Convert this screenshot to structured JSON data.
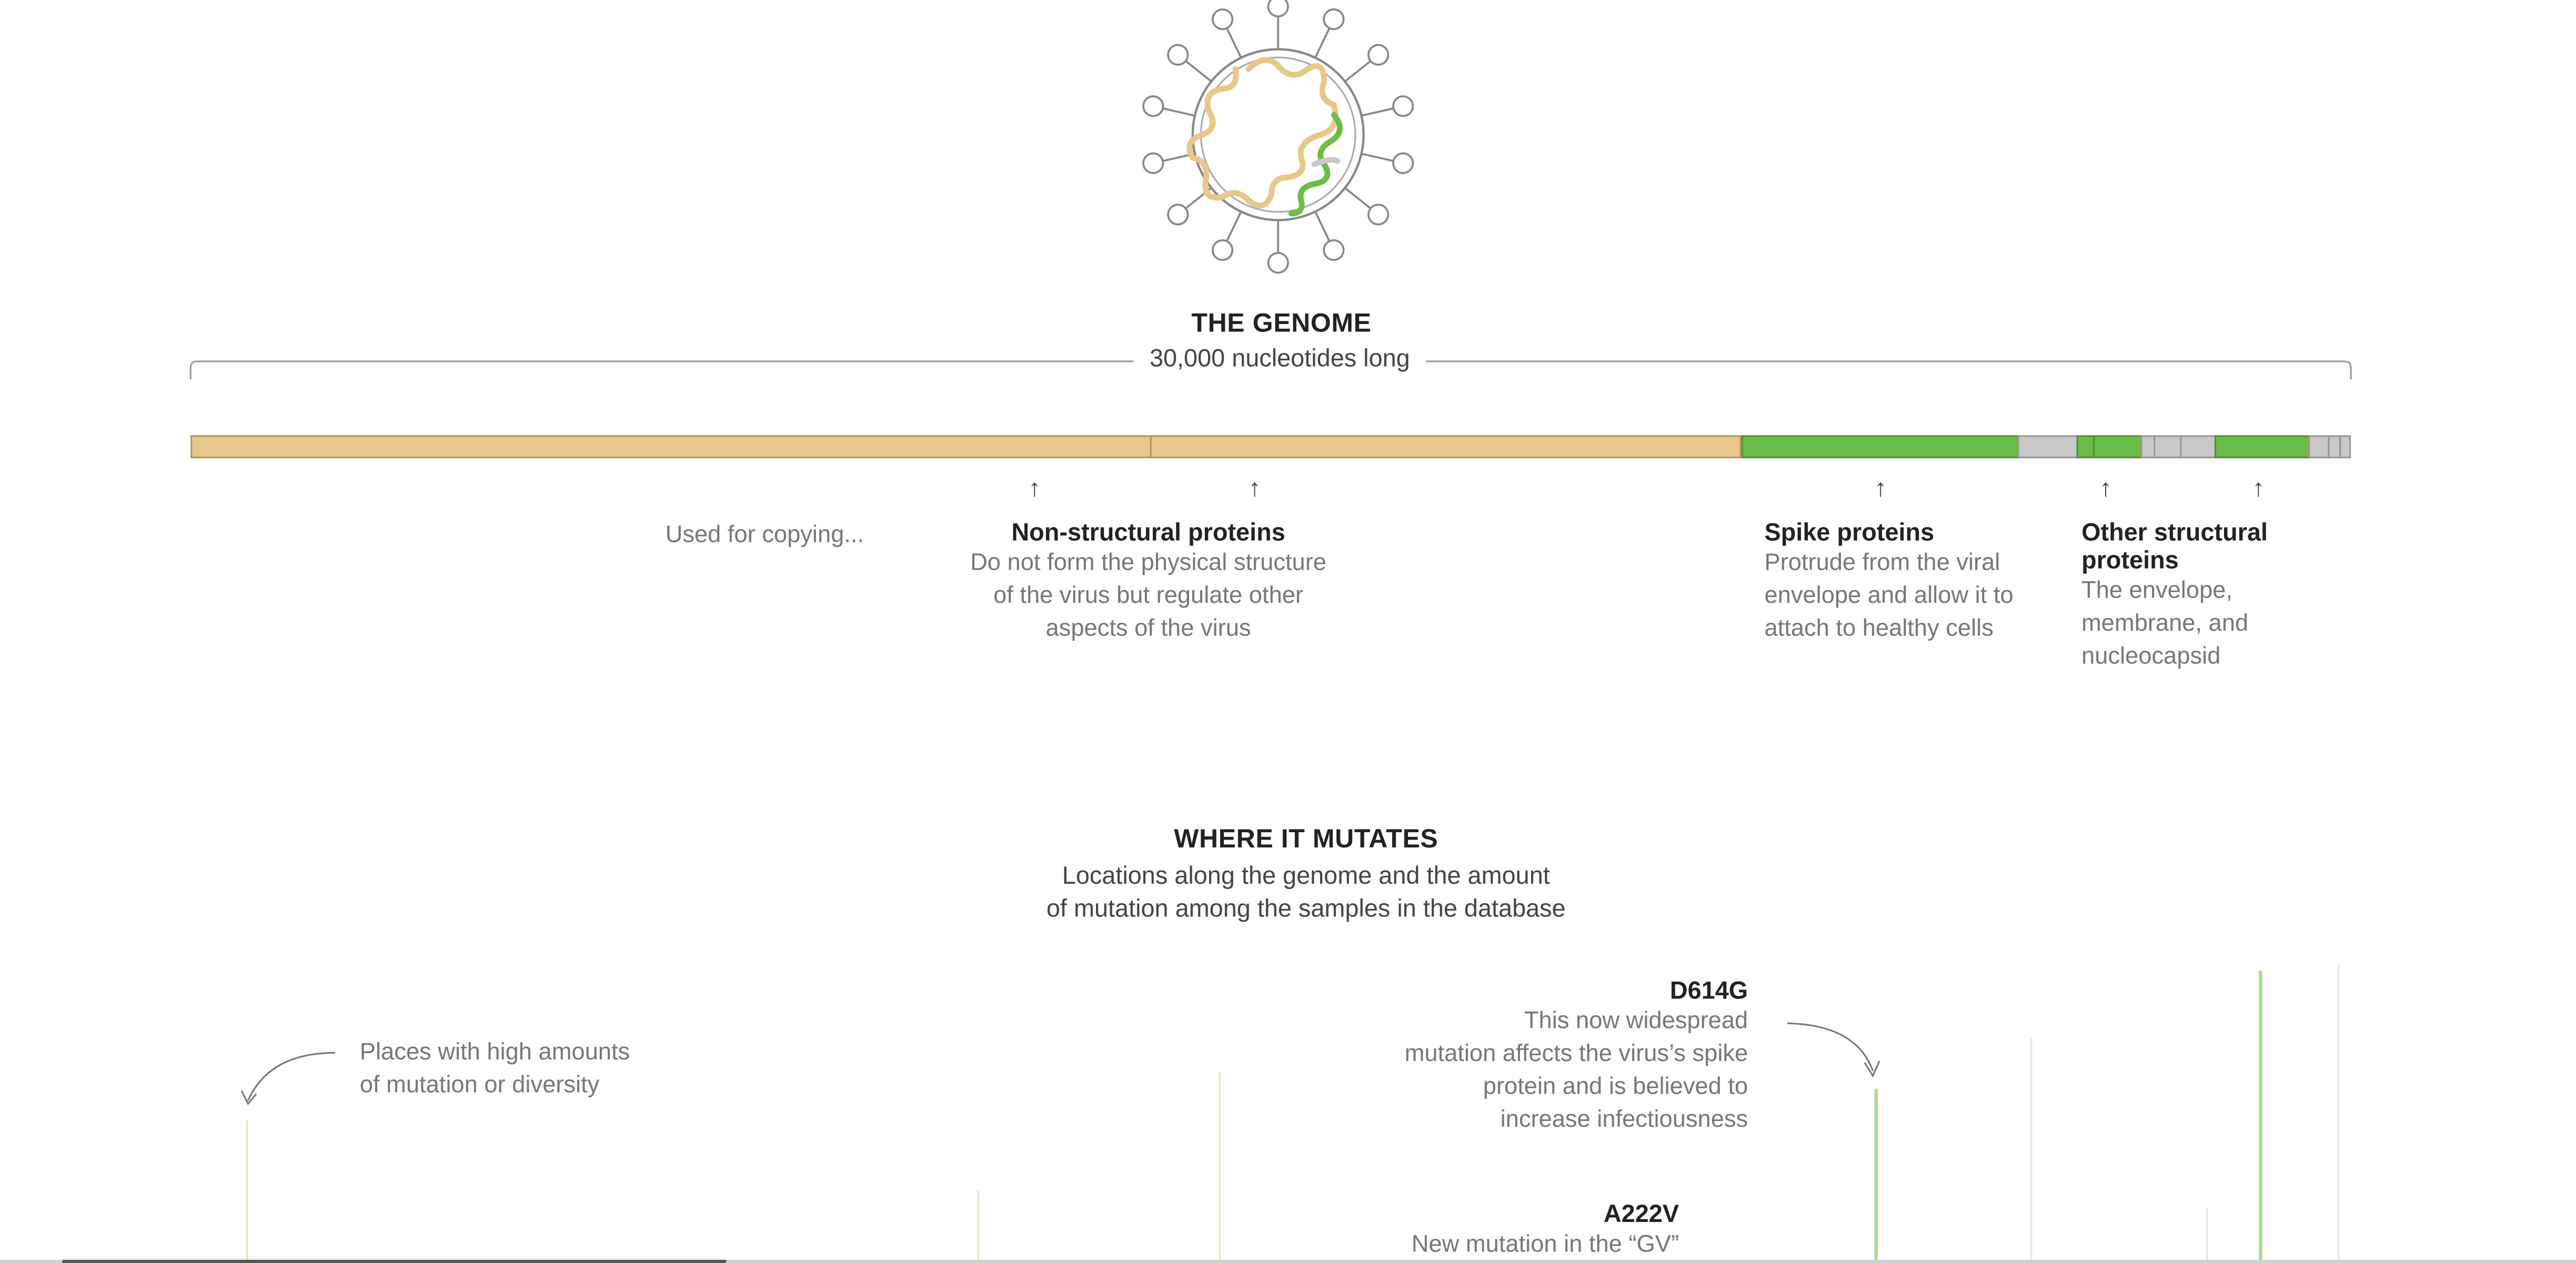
{
  "genome": {
    "title": "THE GENOME",
    "length_label": "30,000 nucleotides long"
  },
  "regions": {
    "used_for_copying": "Used for copying...",
    "non_structural": {
      "title": "Non-structural proteins",
      "lines": [
        "Do not form the physical structure",
        "of the virus but regulate other",
        "aspects of the virus"
      ]
    },
    "spike": {
      "title": "Spike proteins",
      "lines": [
        "Protrude from the viral",
        "envelope and allow it to",
        "attach to healthy cells"
      ]
    },
    "other_structural": {
      "title_lines": [
        "Other structural",
        "proteins"
      ],
      "lines": [
        "The envelope,",
        "membrane, and",
        "nucleocapsid"
      ]
    }
  },
  "mutations": {
    "title": "WHERE IT MUTATES",
    "subtitle_lines": [
      "Locations along the genome and the amount",
      "of mutation among the samples in the database"
    ],
    "high_amounts_lines": [
      "Places with high amounts",
      "of mutation or diversity"
    ],
    "d614g": {
      "title": "D614G",
      "lines": [
        "This now widespread",
        "mutation affects the virus’s spike",
        "protein and is believed to",
        "increase infectiousness"
      ]
    },
    "a222v": {
      "title": "A222V",
      "line": "New mutation in the “GV”"
    }
  },
  "colors": {
    "non_structural": "#e8c888",
    "structural_green": "#6bbd45",
    "gray": "#c8c8c8",
    "line_tan": "#efe0bd",
    "line_green": "#a8dc8c",
    "line_gray": "#e6e6e6"
  }
}
